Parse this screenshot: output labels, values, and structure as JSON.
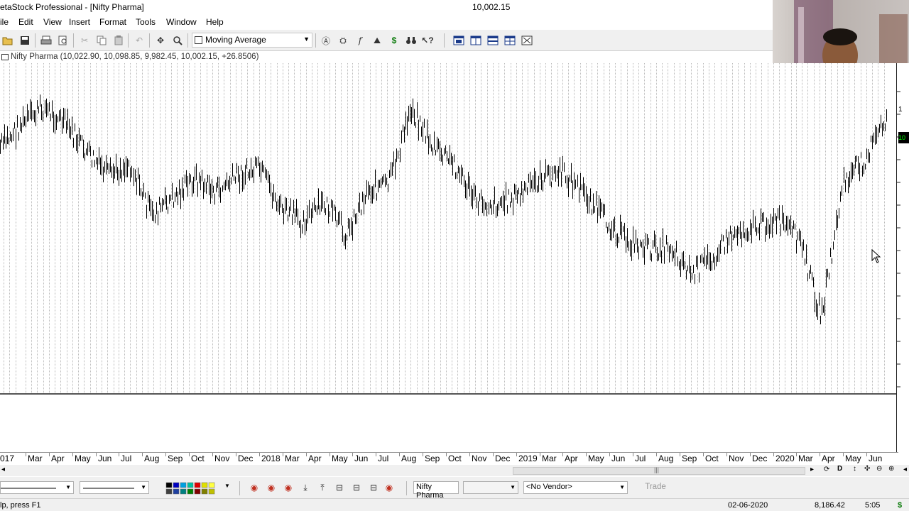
{
  "window": {
    "title": "etaStock Professional - [Nifty Pharma]",
    "last_price": "10,002.15"
  },
  "menu": [
    "ile",
    "Edit",
    "View",
    "Insert",
    "Format",
    "Tools",
    "Window",
    "Help"
  ],
  "toolbar": {
    "indicator_select": "Moving Average",
    "buttons": [
      "open-icon",
      "save-icon",
      "print-icon",
      "print-preview-icon",
      "cut-icon",
      "copy-icon",
      "paste-icon",
      "undo-icon",
      "crosshair-icon",
      "zoom-icon",
      "expert-icon",
      "explorer-icon",
      "formula-icon",
      "system-tester-icon",
      "dollar-icon",
      "binoculars-icon",
      "help-icon",
      "tile-icon",
      "layout-vertical-icon",
      "layout-horizontal-icon",
      "layout-grid-icon",
      "layout-options-icon"
    ]
  },
  "security": {
    "name": "Nifty Pharma",
    "ohlc_text": "Nifty Pharma (10,022.90, 10,098.85, 9,982.45, 10,002.15, +26.8506)"
  },
  "price_tag": "10",
  "right_axis_label": "1",
  "xaxis": {
    "labels": [
      "017",
      "Mar",
      "Apr",
      "May",
      "Jun",
      "Jul",
      "Aug",
      "Sep",
      "Oct",
      "Nov",
      "Dec",
      "2018",
      "Mar",
      "Apr",
      "May",
      "Jun",
      "Jul",
      "Aug",
      "Sep",
      "Oct",
      "Nov",
      "Dec",
      "2019",
      "Mar",
      "Apr",
      "May",
      "Jun",
      "Jul",
      "Aug",
      "Sep",
      "Oct",
      "Nov",
      "Dec",
      "2020",
      "Mar",
      "Apr",
      "May",
      "Jun"
    ]
  },
  "chart_data": {
    "type": "line",
    "title": "",
    "series_name": "Nifty Pharma",
    "x": [
      "2017-01",
      "2017-02",
      "2017-03",
      "2017-04",
      "2017-05",
      "2017-06",
      "2017-07",
      "2017-08",
      "2017-09",
      "2017-10",
      "2017-11",
      "2017-12",
      "2018-01",
      "2018-02",
      "2018-03",
      "2018-04",
      "2018-05",
      "2018-06",
      "2018-07",
      "2018-08",
      "2018-09",
      "2018-10",
      "2018-11",
      "2018-12",
      "2019-01",
      "2019-02",
      "2019-03",
      "2019-04",
      "2019-05",
      "2019-06",
      "2019-07",
      "2019-08",
      "2019-09",
      "2019-10",
      "2019-11",
      "2019-12",
      "2020-01",
      "2020-02",
      "2020-03",
      "2020-04",
      "2020-05",
      "2020-06"
    ],
    "ohlc": {
      "open": 10022.9,
      "high": 10098.85,
      "low": 9982.45,
      "close": 10002.15,
      "change": 26.8506
    },
    "y_relative": [
      0.22,
      0.14,
      0.08,
      0.14,
      0.24,
      0.32,
      0.28,
      0.46,
      0.4,
      0.33,
      0.38,
      0.32,
      0.3,
      0.44,
      0.48,
      0.42,
      0.53,
      0.37,
      0.35,
      0.08,
      0.22,
      0.28,
      0.41,
      0.42,
      0.39,
      0.33,
      0.31,
      0.38,
      0.48,
      0.55,
      0.58,
      0.57,
      0.67,
      0.6,
      0.52,
      0.5,
      0.48,
      0.55,
      0.82,
      0.35,
      0.26,
      0.12
    ],
    "grid": true,
    "legend": "none"
  },
  "bottom": {
    "security_field": "Nifty Pharma",
    "period_select": "",
    "vendor_select": "<No Vendor>",
    "trade_button": "Trade"
  },
  "status": {
    "help": "lp, press F1",
    "date": "02-06-2020",
    "value": "8,186.42",
    "time": "5:05"
  }
}
